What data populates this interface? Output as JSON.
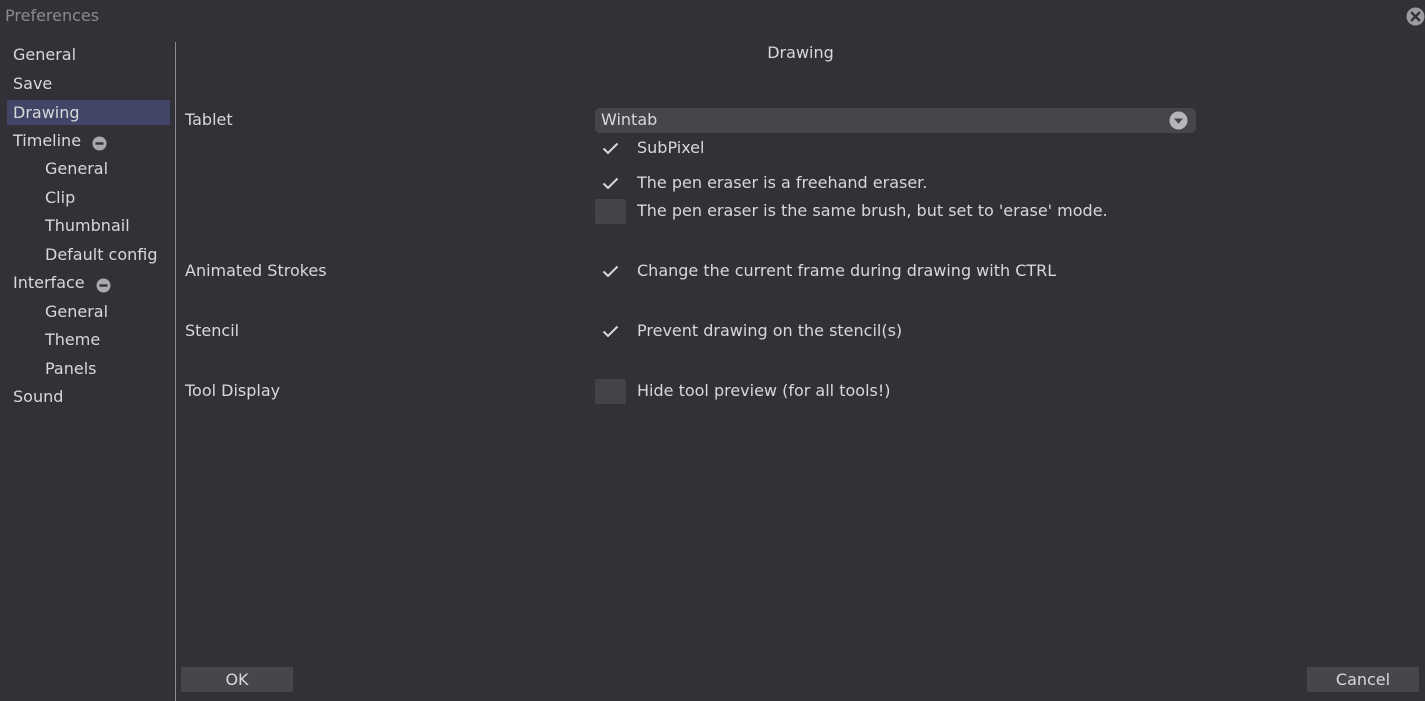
{
  "window": {
    "title": "Preferences"
  },
  "sidebar": {
    "items": [
      {
        "label": "General",
        "level": 0
      },
      {
        "label": "Save",
        "level": 0
      },
      {
        "label": "Drawing",
        "level": 0,
        "selected": true
      },
      {
        "label": "Timeline",
        "level": 0,
        "expanded": true
      },
      {
        "label": "General",
        "level": 1
      },
      {
        "label": "Clip",
        "level": 1
      },
      {
        "label": "Thumbnail",
        "level": 1
      },
      {
        "label": "Default config",
        "level": 1
      },
      {
        "label": "Interface",
        "level": 0,
        "expanded": true
      },
      {
        "label": "General",
        "level": 1
      },
      {
        "label": "Theme",
        "level": 1
      },
      {
        "label": "Panels",
        "level": 1
      },
      {
        "label": "Sound",
        "level": 0
      }
    ]
  },
  "main": {
    "section_title": "Drawing",
    "rows": {
      "tablet": {
        "label": "Tablet"
      },
      "animated_strokes": {
        "label": "Animated Strokes"
      },
      "stencil": {
        "label": "Stencil"
      },
      "tool_display": {
        "label": "Tool Display"
      }
    },
    "tablet_select": {
      "value": "Wintab"
    },
    "options": [
      {
        "label": "SubPixel",
        "checked": true
      },
      {
        "label": "The pen eraser is a freehand eraser.",
        "checked": true
      },
      {
        "label": "The pen eraser is the same brush, but set to 'erase' mode.",
        "checked": false
      },
      {
        "label": "Change the current frame during drawing with CTRL",
        "checked": true
      },
      {
        "label": "Prevent drawing on the stencil(s)",
        "checked": true
      },
      {
        "label": "Hide tool preview (for all tools!)",
        "checked": false
      }
    ]
  },
  "footer": {
    "ok_label": "OK",
    "cancel_label": "Cancel"
  },
  "colors": {
    "background": "#323137",
    "selected_item": "#414567",
    "control": "#46454b",
    "text": "#d8d8d8",
    "title_text": "#8a8a8f"
  },
  "icons": [
    "close-icon",
    "minus-circle-icon",
    "dropdown-arrow-icon",
    "checkmark-icon"
  ]
}
